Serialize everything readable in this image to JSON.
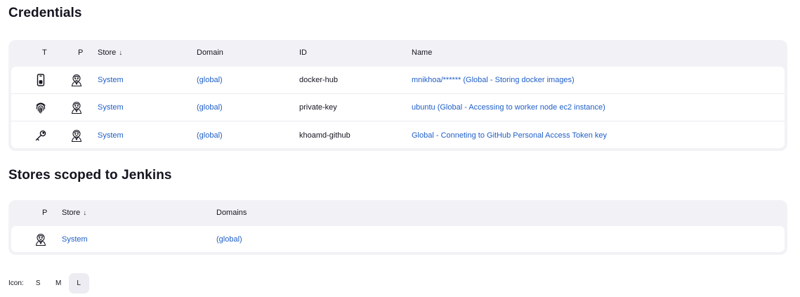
{
  "credentials": {
    "title": "Credentials",
    "columns": {
      "t": "T",
      "p": "P",
      "store": "Store",
      "domain": "Domain",
      "id": "ID",
      "name": "Name"
    },
    "sort_indicator": "↓",
    "rows": [
      {
        "type_icon": "mobile-phone-icon",
        "provider_icon": "jenkins-butler-icon",
        "store": "System",
        "domain": "(global)",
        "id": "docker-hub",
        "name": "mnikhoa/****** (Global - Storing docker images)"
      },
      {
        "type_icon": "fingerprint-icon",
        "provider_icon": "jenkins-butler-icon",
        "store": "System",
        "domain": "(global)",
        "id": "private-key",
        "name": "ubuntu (Global - Accessing to worker node ec2 instance)"
      },
      {
        "type_icon": "key-icon",
        "provider_icon": "jenkins-butler-icon",
        "store": "System",
        "domain": "(global)",
        "id": "khoamd-github",
        "name": "Global - Conneting to GitHub Personal Access Token key"
      }
    ]
  },
  "stores": {
    "title": "Stores scoped to Jenkins",
    "columns": {
      "p": "P",
      "store": "Store",
      "domains": "Domains"
    },
    "sort_indicator": "↓",
    "rows": [
      {
        "provider_icon": "jenkins-butler-icon",
        "store": "System",
        "domains": "(global)"
      }
    ]
  },
  "icon_size": {
    "label": "Icon:",
    "options": [
      "S",
      "M",
      "L"
    ],
    "selected": "L"
  },
  "colors": {
    "link": "#1f5fc7",
    "table_bg": "#f2f2f6"
  }
}
